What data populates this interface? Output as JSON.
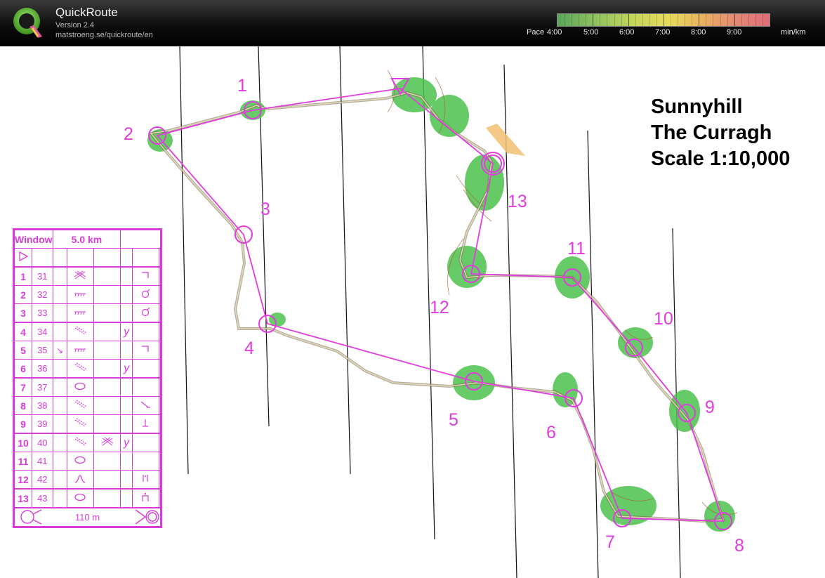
{
  "app": {
    "name": "QuickRoute",
    "version": "Version 2.4",
    "url": "matstroeng.se/quickroute/en"
  },
  "pace_legend": {
    "label": "Pace",
    "ticks": [
      "4:00",
      "5:00",
      "6:00",
      "7:00",
      "8:00",
      "9:00"
    ],
    "unit": "min/km",
    "colors": {
      "fast": "#5aa55a",
      "medium": "#e6dc5c",
      "slow": "#e06d78"
    }
  },
  "map": {
    "title_lines": [
      "Sunnyhill",
      "The Curragh",
      "Scale 1:10,000"
    ],
    "course_color": "#e03ce0",
    "route_color": "#7a6a4a",
    "controls": [
      {
        "number": "1"
      },
      {
        "number": "2"
      },
      {
        "number": "3"
      },
      {
        "number": "4"
      },
      {
        "number": "5"
      },
      {
        "number": "6"
      },
      {
        "number": "7"
      },
      {
        "number": "8"
      },
      {
        "number": "9"
      },
      {
        "number": "10"
      },
      {
        "number": "11"
      },
      {
        "number": "12"
      },
      {
        "number": "13"
      }
    ]
  },
  "control_descriptions": {
    "header": {
      "event": "Window",
      "length": "5.0 km"
    },
    "rows": [
      {
        "num": "1",
        "code": "31",
        "sym_d": "thicket-icon",
        "sym_g": "corner-icon"
      },
      {
        "num": "2",
        "code": "32",
        "sym_d": "vegetation-edge-icon",
        "sym_g": "root-stock-icon"
      },
      {
        "num": "3",
        "code": "33",
        "sym_d": "vegetation-edge-icon",
        "sym_g": "root-stock-icon"
      },
      {
        "num": "4",
        "code": "34",
        "sym_d": "rides-icon",
        "sym_f": "y",
        "sym_f_icon": "junction-icon"
      },
      {
        "num": "5",
        "code": "35",
        "sym_c": "↘",
        "sym_d": "vegetation-edge-icon",
        "sym_g": "corner-icon"
      },
      {
        "num": "6",
        "code": "36",
        "sym_d": "rides-icon",
        "sym_f": "y",
        "sym_f_icon": "junction-icon"
      },
      {
        "num": "7",
        "code": "37",
        "sym_d": "knoll-icon"
      },
      {
        "num": "8",
        "code": "38",
        "sym_d": "rides-icon",
        "sym_g": "end-icon"
      },
      {
        "num": "9",
        "code": "39",
        "sym_d": "rides-icon",
        "sym_g": "foot-icon"
      },
      {
        "num": "10",
        "code": "40",
        "sym_d": "rides-icon",
        "sym_e": "thicket-icon",
        "sym_f": "y",
        "sym_f_icon": "junction-icon"
      },
      {
        "num": "11",
        "code": "41",
        "sym_d": "knoll-icon"
      },
      {
        "num": "12",
        "code": "42",
        "sym_d": "hill-icon",
        "sym_g": "between-icon"
      },
      {
        "num": "13",
        "code": "43",
        "sym_d": "knoll-icon",
        "sym_g": "top-icon"
      }
    ],
    "finish": {
      "distance": "110 m"
    }
  }
}
